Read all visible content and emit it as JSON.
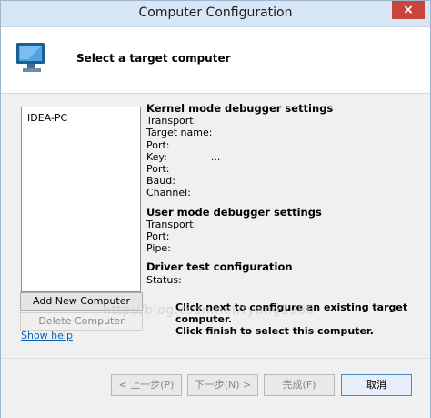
{
  "window": {
    "title": "Computer Configuration",
    "close_icon": "close-icon"
  },
  "header": {
    "title": "Select a target computer"
  },
  "computers": [
    "IDEA-PC"
  ],
  "buttons": {
    "add": "Add New Computer",
    "delete": "Delete Computer",
    "help": "Show help"
  },
  "details": {
    "kernel": {
      "title": "Kernel mode debugger settings",
      "rows": [
        "Transport:",
        "Target name:",
        "Port:",
        "Key:",
        "Port:",
        "Baud:",
        "Channel:"
      ],
      "key_value": "..."
    },
    "user": {
      "title": "User mode debugger settings",
      "rows": [
        "Transport:",
        "Port:",
        "Pipe:"
      ]
    },
    "driver": {
      "title": "Driver test configuration",
      "rows": [
        "Status:"
      ]
    }
  },
  "help_text": {
    "line1": "Click next to configure an existing target",
    "line2": "computer.",
    "line3": "Click finish to select this computer."
  },
  "watermark": "http://blog.csdn.net/tyang1986",
  "footer": {
    "back": "< 上一步(P)",
    "next": "下一步(N) >",
    "finish": "完成(F)",
    "cancel": "取消"
  }
}
